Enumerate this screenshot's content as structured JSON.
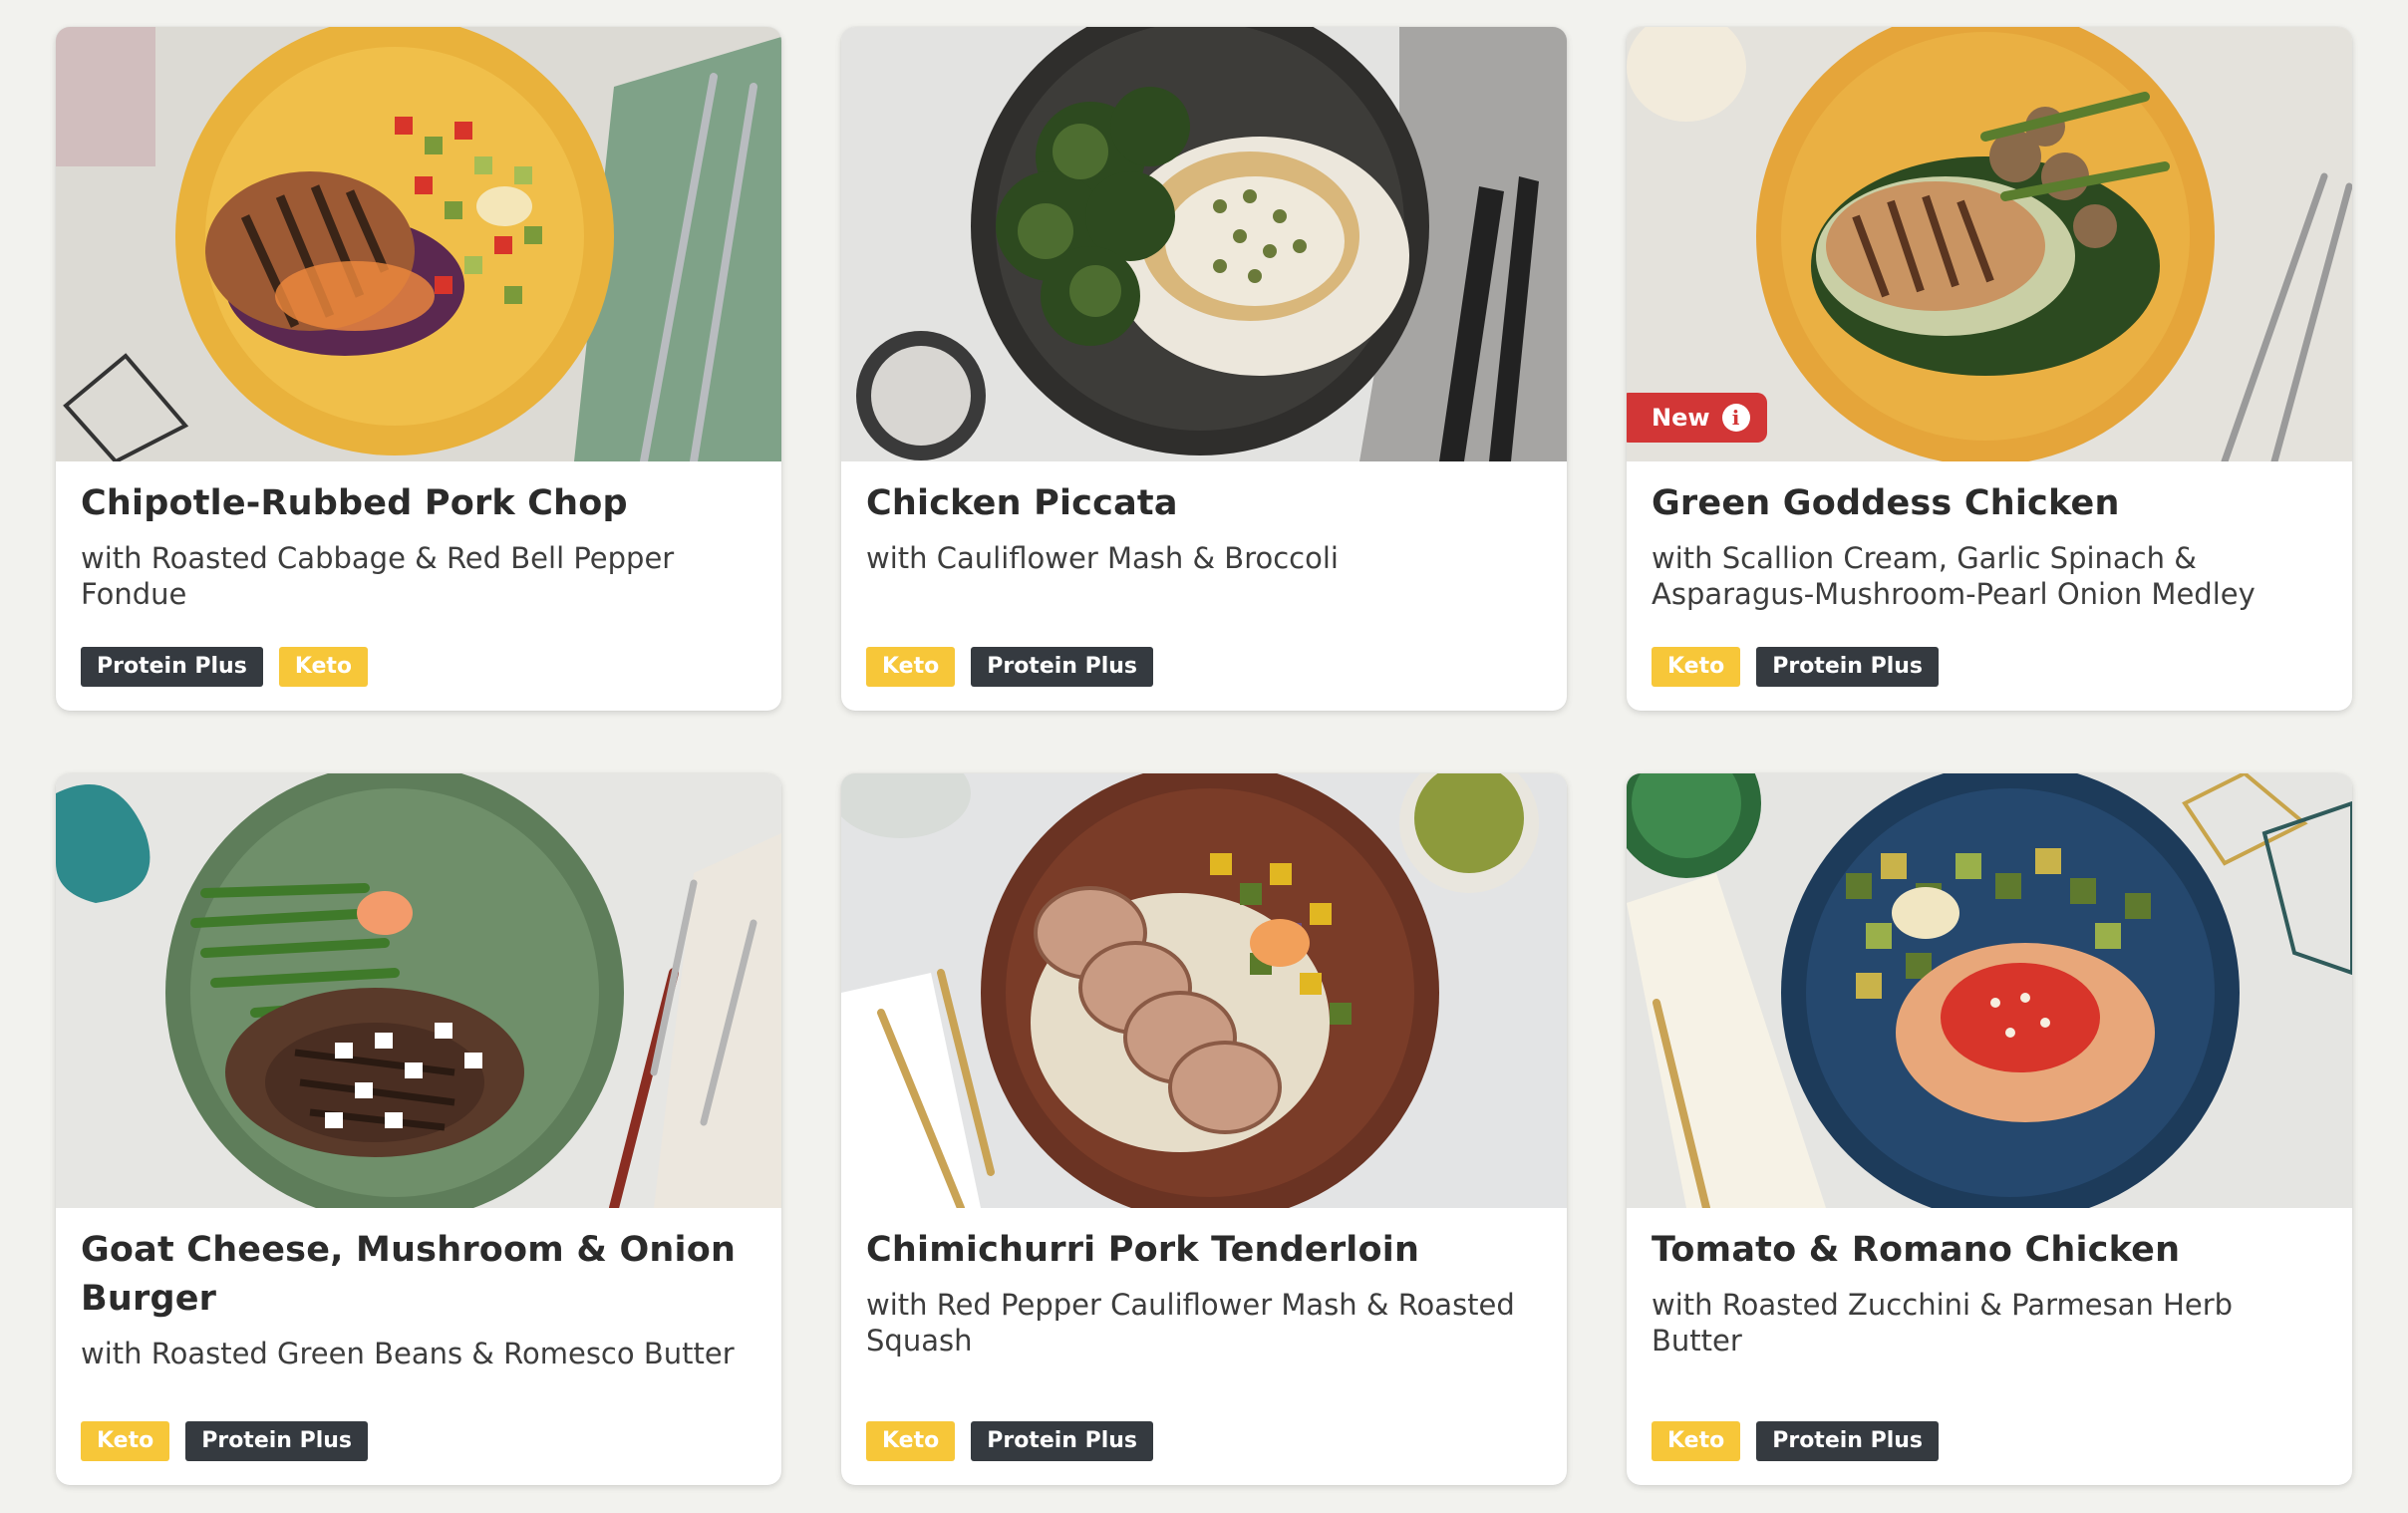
{
  "badges": {
    "new_label": "New"
  },
  "colors": {
    "keto_tag": "#f7c739",
    "protein_tag": "#353a40",
    "new_badge": "#d23636",
    "page_background": "#f2f2ee"
  },
  "recipes": [
    {
      "title": "Chipotle-Rubbed Pork Chop",
      "subtitle": "with Roasted Cabbage & Red Bell Pepper Fondue",
      "tags": [
        "Protein Plus",
        "Keto"
      ],
      "is_new": false
    },
    {
      "title": "Chicken Piccata",
      "subtitle": "with Cauliflower Mash & Broccoli",
      "tags": [
        "Keto",
        "Protein Plus"
      ],
      "is_new": false
    },
    {
      "title": "Green Goddess Chicken",
      "subtitle": "with Scallion Cream, Garlic Spinach & Asparagus-Mushroom-Pearl Onion Medley",
      "tags": [
        "Keto",
        "Protein Plus"
      ],
      "is_new": true
    },
    {
      "title": "Goat Cheese, Mushroom & Onion Burger",
      "subtitle": "with Roasted Green Beans & Romesco Butter",
      "tags": [
        "Keto",
        "Protein Plus"
      ],
      "is_new": false
    },
    {
      "title": "Chimichurri Pork Tenderloin",
      "subtitle": "with Red Pepper Cauliflower Mash & Roasted Squash",
      "tags": [
        "Keto",
        "Protein Plus"
      ],
      "is_new": false
    },
    {
      "title": "Tomato & Romano Chicken",
      "subtitle": "with Roasted Zucchini & Parmesan Herb Butter",
      "tags": [
        "Keto",
        "Protein Plus"
      ],
      "is_new": false
    }
  ]
}
